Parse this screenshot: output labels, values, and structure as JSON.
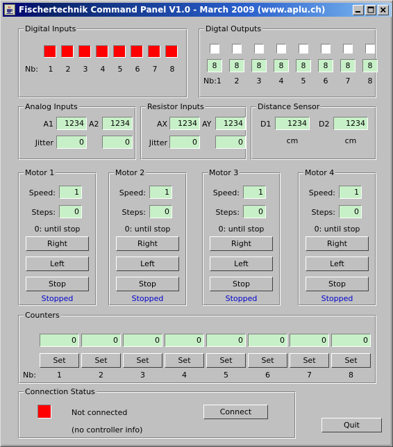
{
  "window": {
    "title": "Fischertechnik Command Panel V1.0 - March 2009 (www.aplu.ch)",
    "icon": "java-coffee-cup-icon",
    "minimize_label": "–",
    "maximize_label": "□",
    "close_label": "✕",
    "bg_color": "#c0c0c0",
    "titlebar_color": "#0a246a"
  },
  "digital_inputs": {
    "title": "Digital Inputs",
    "nb_label": "Nb:",
    "numbers": [
      "1",
      "2",
      "3",
      "4",
      "5",
      "6",
      "7",
      "8"
    ],
    "led_color": "#ff0000",
    "led_states": [
      "on",
      "on",
      "on",
      "on",
      "on",
      "on",
      "on",
      "on"
    ]
  },
  "digital_outputs": {
    "title": "Digtal Outputs",
    "nb_label": "Nb:1",
    "numbers": [
      "2",
      "3",
      "4",
      "5",
      "6",
      "7",
      "8"
    ],
    "checkboxes": [
      false,
      false,
      false,
      false,
      false,
      false,
      false,
      false
    ],
    "values": [
      "8",
      "8",
      "8",
      "8",
      "8",
      "8",
      "8",
      "8"
    ]
  },
  "analog_inputs": {
    "title": "Analog Inputs",
    "a1_label": "A1",
    "a1_value": "1234",
    "a2_label": "A2",
    "a2_value": "1234",
    "jitter_label": "Jitter",
    "jitter1_value": "0",
    "jitter2_value": "0"
  },
  "resistor_inputs": {
    "title": "Resistor Inputs",
    "ax_label": "AX",
    "ax_value": "1234",
    "ay_label": "AY",
    "ay_value": "1234",
    "jitter_label": "Jitter",
    "jitter1_value": "0",
    "jitter2_value": "0"
  },
  "distance_sensor": {
    "title": "Distance Sensor",
    "d1_label": "D1",
    "d1_value": "1234",
    "d2_label": "D2",
    "d2_value": "1234",
    "unit1": "cm",
    "unit2": "cm"
  },
  "motors": [
    {
      "title": "Motor 1",
      "speed_label": "Speed:",
      "speed_value": "1",
      "steps_label": "Steps:",
      "steps_value": "0",
      "hint": "0: until stop",
      "right_label": "Right",
      "left_label": "Left",
      "stop_label": "Stop",
      "status": "Stopped"
    },
    {
      "title": "Motor 2",
      "speed_label": "Speed:",
      "speed_value": "1",
      "steps_label": "Steps:",
      "steps_value": "0",
      "hint": "0: until stop",
      "right_label": "Right",
      "left_label": "Left",
      "stop_label": "Stop",
      "status": "Stopped"
    },
    {
      "title": "Motor 3",
      "speed_label": "Speed:",
      "speed_value": "1",
      "steps_label": "Steps:",
      "steps_value": "0",
      "hint": "0: until stop",
      "right_label": "Right",
      "left_label": "Left",
      "stop_label": "Stop",
      "status": "Stopped"
    },
    {
      "title": "Motor 4",
      "speed_label": "Speed:",
      "speed_value": "1",
      "steps_label": "Steps:",
      "steps_value": "0",
      "hint": "0: until stop",
      "right_label": "Right",
      "left_label": "Left",
      "stop_label": "Stop",
      "status": "Stopped"
    }
  ],
  "counters": {
    "title": "Counters",
    "nb_label": "Nb:",
    "values": [
      "0",
      "0",
      "0",
      "0",
      "0",
      "0",
      "0",
      "0"
    ],
    "set_label": "Set",
    "set_labels": [
      "Set",
      "Set",
      "Set",
      "Set",
      "Set",
      "Set",
      "Set",
      "Set"
    ],
    "numbers": [
      "1",
      "2",
      "3",
      "4",
      "5",
      "6",
      "7",
      "8"
    ]
  },
  "connection_status": {
    "title": "Connection Status",
    "led_color": "#ff0000",
    "status_text": "Not connected",
    "info_text": "(no controller info)",
    "connect_label": "Connect"
  },
  "quit": {
    "label": "Quit"
  },
  "colors": {
    "field_bg": "#c8f0c8",
    "status_blue": "#0000cc",
    "led_red": "#ff0000",
    "face": "#c0c0c0"
  }
}
